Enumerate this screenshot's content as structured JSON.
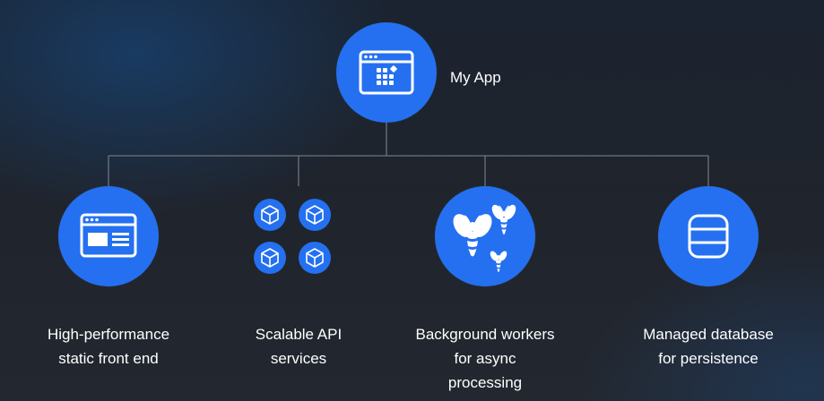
{
  "diagram": {
    "root": {
      "label": "My App",
      "icon": "app-window-icon"
    },
    "nodes": [
      {
        "id": "frontend",
        "label": "High-performance\nstatic front end",
        "icon": "browser-window-icon"
      },
      {
        "id": "api",
        "label": "Scalable API\nservices",
        "icon": "cube-cluster-icon"
      },
      {
        "id": "workers",
        "label": "Background workers\nfor async\nprocessing",
        "icon": "worker-bees-icon"
      },
      {
        "id": "database",
        "label": "Managed database\nfor persistence",
        "icon": "database-icon"
      }
    ],
    "colors": {
      "accent": "#2470f0",
      "connector": "#6e747c",
      "text": "#ffffff",
      "background": "#20242c"
    }
  }
}
